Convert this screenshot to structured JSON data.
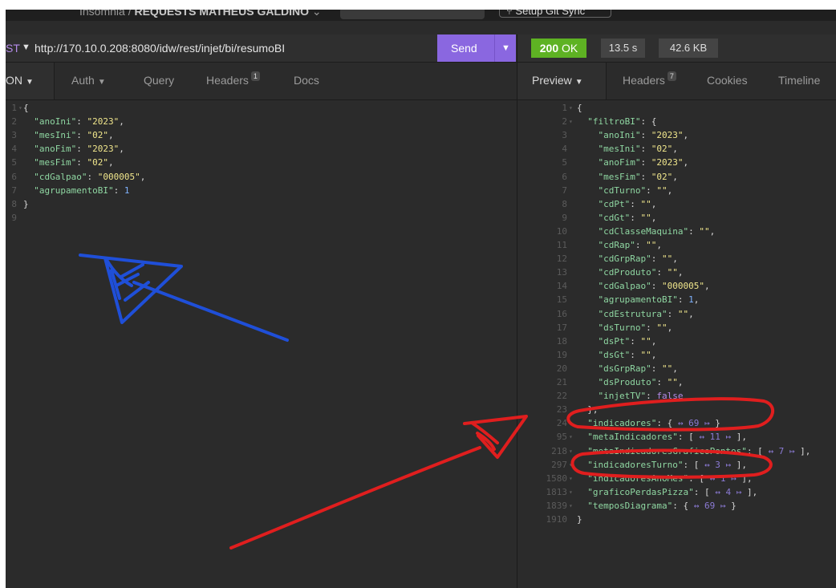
{
  "titlebar": {
    "crumb_app": "Insomnia /",
    "crumb_collection": "REQUESTS MATHEUS GALDINO",
    "env_label": "",
    "git_sync": "⑂ Setup Git Sync"
  },
  "request": {
    "method": "ST",
    "url": "http://170.10.0.208:8080/idw/rest/injet/bi/resumoBI",
    "send_label": "Send",
    "tabs": {
      "body": "ON",
      "auth": "Auth",
      "query": "Query",
      "headers": "Headers",
      "headers_count": "1",
      "docs": "Docs"
    },
    "body_lines": [
      {
        "n": "1",
        "fold": true,
        "text": [
          [
            "p",
            "{"
          ]
        ]
      },
      {
        "n": "2",
        "text": [
          [
            "p",
            "  "
          ],
          [
            "k",
            "\"anoIni\""
          ],
          [
            "p",
            ": "
          ],
          [
            "s",
            "\"2023\""
          ],
          [
            "p",
            ","
          ]
        ]
      },
      {
        "n": "3",
        "text": [
          [
            "p",
            "  "
          ],
          [
            "k",
            "\"mesIni\""
          ],
          [
            "p",
            ": "
          ],
          [
            "s",
            "\"02\""
          ],
          [
            "p",
            ","
          ]
        ]
      },
      {
        "n": "4",
        "text": [
          [
            "p",
            "  "
          ],
          [
            "k",
            "\"anoFim\""
          ],
          [
            "p",
            ": "
          ],
          [
            "s",
            "\"2023\""
          ],
          [
            "p",
            ","
          ]
        ]
      },
      {
        "n": "5",
        "text": [
          [
            "p",
            "  "
          ],
          [
            "k",
            "\"mesFim\""
          ],
          [
            "p",
            ": "
          ],
          [
            "s",
            "\"02\""
          ],
          [
            "p",
            ","
          ]
        ]
      },
      {
        "n": "6",
        "text": [
          [
            "p",
            "  "
          ],
          [
            "k",
            "\"cdGalpao\""
          ],
          [
            "p",
            ": "
          ],
          [
            "s",
            "\"000005\""
          ],
          [
            "p",
            ","
          ]
        ]
      },
      {
        "n": "7",
        "text": [
          [
            "p",
            "  "
          ],
          [
            "k",
            "\"agrupamentoBI\""
          ],
          [
            "p",
            ": "
          ],
          [
            "n",
            "1"
          ]
        ]
      },
      {
        "n": "8",
        "text": [
          [
            "p",
            "}"
          ]
        ]
      },
      {
        "n": "9",
        "text": []
      }
    ]
  },
  "response": {
    "status_code": "200",
    "status_text": "OK",
    "time": "13.5 s",
    "size": "42.6 KB",
    "tabs": {
      "preview": "Preview",
      "headers": "Headers",
      "headers_count": "7",
      "cookies": "Cookies",
      "timeline": "Timeline"
    },
    "body_lines": [
      {
        "n": "1",
        "fold": true,
        "text": [
          [
            "p",
            "{"
          ]
        ]
      },
      {
        "n": "2",
        "fold": true,
        "text": [
          [
            "p",
            "  "
          ],
          [
            "k",
            "\"filtroBI\""
          ],
          [
            "p",
            ": {"
          ]
        ]
      },
      {
        "n": "3",
        "text": [
          [
            "p",
            "    "
          ],
          [
            "k",
            "\"anoIni\""
          ],
          [
            "p",
            ": "
          ],
          [
            "s",
            "\"2023\""
          ],
          [
            "p",
            ","
          ]
        ]
      },
      {
        "n": "4",
        "text": [
          [
            "p",
            "    "
          ],
          [
            "k",
            "\"mesIni\""
          ],
          [
            "p",
            ": "
          ],
          [
            "s",
            "\"02\""
          ],
          [
            "p",
            ","
          ]
        ]
      },
      {
        "n": "5",
        "text": [
          [
            "p",
            "    "
          ],
          [
            "k",
            "\"anoFim\""
          ],
          [
            "p",
            ": "
          ],
          [
            "s",
            "\"2023\""
          ],
          [
            "p",
            ","
          ]
        ]
      },
      {
        "n": "6",
        "text": [
          [
            "p",
            "    "
          ],
          [
            "k",
            "\"mesFim\""
          ],
          [
            "p",
            ": "
          ],
          [
            "s",
            "\"02\""
          ],
          [
            "p",
            ","
          ]
        ]
      },
      {
        "n": "7",
        "text": [
          [
            "p",
            "    "
          ],
          [
            "k",
            "\"cdTurno\""
          ],
          [
            "p",
            ": "
          ],
          [
            "s",
            "\"\""
          ],
          [
            "p",
            ","
          ]
        ]
      },
      {
        "n": "8",
        "text": [
          [
            "p",
            "    "
          ],
          [
            "k",
            "\"cdPt\""
          ],
          [
            "p",
            ": "
          ],
          [
            "s",
            "\"\""
          ],
          [
            "p",
            ","
          ]
        ]
      },
      {
        "n": "9",
        "text": [
          [
            "p",
            "    "
          ],
          [
            "k",
            "\"cdGt\""
          ],
          [
            "p",
            ": "
          ],
          [
            "s",
            "\"\""
          ],
          [
            "p",
            ","
          ]
        ]
      },
      {
        "n": "10",
        "text": [
          [
            "p",
            "    "
          ],
          [
            "k",
            "\"cdClasseMaquina\""
          ],
          [
            "p",
            ": "
          ],
          [
            "s",
            "\"\""
          ],
          [
            "p",
            ","
          ]
        ]
      },
      {
        "n": "11",
        "text": [
          [
            "p",
            "    "
          ],
          [
            "k",
            "\"cdRap\""
          ],
          [
            "p",
            ": "
          ],
          [
            "s",
            "\"\""
          ],
          [
            "p",
            ","
          ]
        ]
      },
      {
        "n": "12",
        "text": [
          [
            "p",
            "    "
          ],
          [
            "k",
            "\"cdGrpRap\""
          ],
          [
            "p",
            ": "
          ],
          [
            "s",
            "\"\""
          ],
          [
            "p",
            ","
          ]
        ]
      },
      {
        "n": "13",
        "text": [
          [
            "p",
            "    "
          ],
          [
            "k",
            "\"cdProduto\""
          ],
          [
            "p",
            ": "
          ],
          [
            "s",
            "\"\""
          ],
          [
            "p",
            ","
          ]
        ]
      },
      {
        "n": "14",
        "text": [
          [
            "p",
            "    "
          ],
          [
            "k",
            "\"cdGalpao\""
          ],
          [
            "p",
            ": "
          ],
          [
            "s",
            "\"000005\""
          ],
          [
            "p",
            ","
          ]
        ]
      },
      {
        "n": "15",
        "text": [
          [
            "p",
            "    "
          ],
          [
            "k",
            "\"agrupamentoBI\""
          ],
          [
            "p",
            ": "
          ],
          [
            "n",
            "1"
          ],
          [
            "p",
            ","
          ]
        ]
      },
      {
        "n": "16",
        "text": [
          [
            "p",
            "    "
          ],
          [
            "k",
            "\"cdEstrutura\""
          ],
          [
            "p",
            ": "
          ],
          [
            "s",
            "\"\""
          ],
          [
            "p",
            ","
          ]
        ]
      },
      {
        "n": "17",
        "text": [
          [
            "p",
            "    "
          ],
          [
            "k",
            "\"dsTurno\""
          ],
          [
            "p",
            ": "
          ],
          [
            "s",
            "\"\""
          ],
          [
            "p",
            ","
          ]
        ]
      },
      {
        "n": "18",
        "text": [
          [
            "p",
            "    "
          ],
          [
            "k",
            "\"dsPt\""
          ],
          [
            "p",
            ": "
          ],
          [
            "s",
            "\"\""
          ],
          [
            "p",
            ","
          ]
        ]
      },
      {
        "n": "19",
        "text": [
          [
            "p",
            "    "
          ],
          [
            "k",
            "\"dsGt\""
          ],
          [
            "p",
            ": "
          ],
          [
            "s",
            "\"\""
          ],
          [
            "p",
            ","
          ]
        ]
      },
      {
        "n": "20",
        "text": [
          [
            "p",
            "    "
          ],
          [
            "k",
            "\"dsGrpRap\""
          ],
          [
            "p",
            ": "
          ],
          [
            "s",
            "\"\""
          ],
          [
            "p",
            ","
          ]
        ]
      },
      {
        "n": "21",
        "text": [
          [
            "p",
            "    "
          ],
          [
            "k",
            "\"dsProduto\""
          ],
          [
            "p",
            ": "
          ],
          [
            "s",
            "\"\""
          ],
          [
            "p",
            ","
          ]
        ]
      },
      {
        "n": "22",
        "text": [
          [
            "p",
            "    "
          ],
          [
            "k",
            "\"injetTV\""
          ],
          [
            "p",
            ": "
          ],
          [
            "b",
            "false"
          ]
        ]
      },
      {
        "n": "23",
        "text": [
          [
            "p",
            "  },"
          ]
        ]
      },
      {
        "n": "24",
        "fold": true,
        "text": [
          [
            "p",
            "  "
          ],
          [
            "k",
            "\"indicadores\""
          ],
          [
            "p",
            ": { "
          ],
          [
            "c",
            "↔ 69 ↦"
          ],
          [
            "p",
            " }"
          ]
        ]
      },
      {
        "n": "95",
        "fold": true,
        "text": [
          [
            "p",
            "  "
          ],
          [
            "k",
            "\"metaIndicadores\""
          ],
          [
            "p",
            ": [ "
          ],
          [
            "c",
            "↔ 11 ↦"
          ],
          [
            "p",
            " ],"
          ]
        ]
      },
      {
        "n": "218",
        "fold": true,
        "text": [
          [
            "p",
            "  "
          ],
          [
            "k",
            "\"metaIndicadoresGraficoPontos\""
          ],
          [
            "p",
            ": [ "
          ],
          [
            "c",
            "↔ 7 ↦"
          ],
          [
            "p",
            " ],"
          ]
        ]
      },
      {
        "n": "297",
        "fold": true,
        "text": [
          [
            "p",
            "  "
          ],
          [
            "k",
            "\"indicadoresTurno\""
          ],
          [
            "p",
            ": [ "
          ],
          [
            "c",
            "↔ 3 ↦"
          ],
          [
            "p",
            " ],"
          ]
        ]
      },
      {
        "n": "1580",
        "fold": true,
        "text": [
          [
            "p",
            "  "
          ],
          [
            "k",
            "\"indicadoresAnoMes\""
          ],
          [
            "p",
            ": [ "
          ],
          [
            "c",
            "↔ 1 ↦"
          ],
          [
            "p",
            " ],"
          ]
        ]
      },
      {
        "n": "1813",
        "fold": true,
        "text": [
          [
            "p",
            "  "
          ],
          [
            "k",
            "\"graficoPerdasPizza\""
          ],
          [
            "p",
            ": [ "
          ],
          [
            "c",
            "↔ 4 ↦"
          ],
          [
            "p",
            " ],"
          ]
        ]
      },
      {
        "n": "1839",
        "fold": true,
        "text": [
          [
            "p",
            "  "
          ],
          [
            "k",
            "\"temposDiagrama\""
          ],
          [
            "p",
            ": { "
          ],
          [
            "c",
            "↔ 69 ↦"
          ],
          [
            "p",
            " }"
          ]
        ]
      },
      {
        "n": "1910",
        "text": [
          [
            "p",
            "}"
          ]
        ]
      }
    ]
  },
  "colors": {
    "send": "#8a67e0",
    "status_ok": "#5eb223",
    "annotation_blue": "#1f4fd8",
    "annotation_red": "#e01e1e"
  }
}
